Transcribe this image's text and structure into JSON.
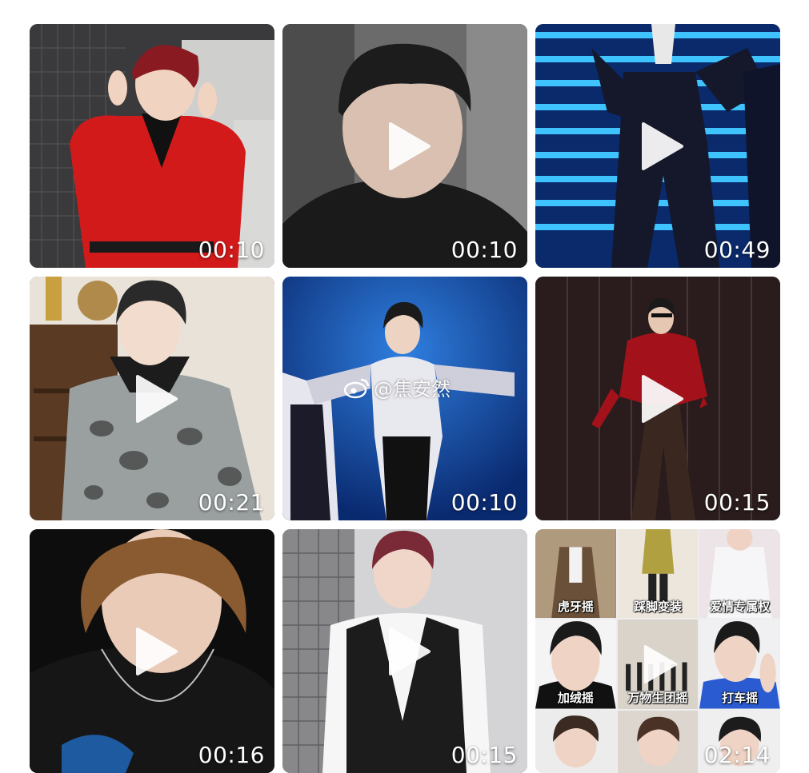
{
  "grid": {
    "tiles": [
      {
        "duration": "00:10",
        "theme": "red-blazer-studio"
      },
      {
        "duration": "00:10",
        "theme": "closeup-grey-room"
      },
      {
        "duration": "00:49",
        "theme": "stage-blue-suit"
      },
      {
        "duration": "00:21",
        "theme": "leopard-jacket-room"
      },
      {
        "duration": "00:10",
        "theme": "blue-stage-dance"
      },
      {
        "duration": "00:15",
        "theme": "red-shirt-stage"
      },
      {
        "duration": "00:16",
        "theme": "dark-closeup"
      },
      {
        "duration": "00:15",
        "theme": "black-vest-studio"
      },
      {
        "duration": "02:14",
        "theme": "collage"
      }
    ],
    "watermark": "@焦安然",
    "collage_labels": [
      "虎牙摇",
      "踩脚变装",
      "爱情专属权",
      "加绒摇",
      "万物生团摇",
      "打车摇",
      "",
      "",
      ""
    ]
  },
  "colors": {
    "play": "#ffffff",
    "duration_text": "#ffffff",
    "background": "#ffffff"
  }
}
